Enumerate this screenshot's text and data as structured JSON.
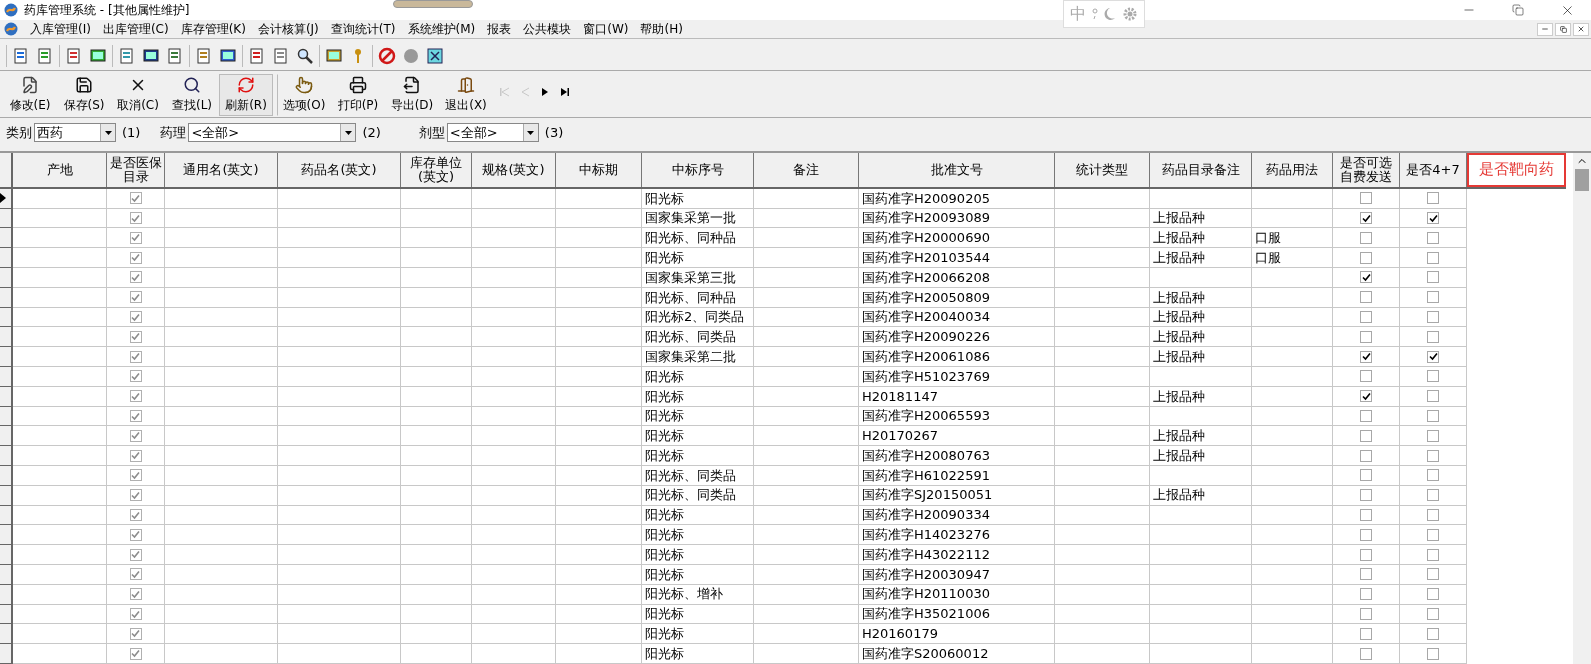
{
  "window": {
    "title": "药库管理系统 - [其他属性维护]"
  },
  "ime": {
    "label": "中"
  },
  "menu": [
    {
      "label": "入库管理(I)"
    },
    {
      "label": "出库管理(C)"
    },
    {
      "label": "库存管理(K)"
    },
    {
      "label": "会计核算(J)"
    },
    {
      "label": "查询统计(T)"
    },
    {
      "label": "系统维护(M)"
    },
    {
      "label": "报表"
    },
    {
      "label": "公共模块"
    },
    {
      "label": "窗口(W)"
    },
    {
      "label": "帮助(H)"
    }
  ],
  "toolbar": [
    {
      "label": "修改(E)",
      "kind": "edit",
      "pressed": false
    },
    {
      "label": "保存(S)",
      "kind": "save",
      "pressed": false
    },
    {
      "label": "取消(C)",
      "kind": "cancel",
      "pressed": false
    },
    {
      "label": "查找(L)",
      "kind": "find",
      "pressed": false
    },
    {
      "label": "刷新(R)",
      "kind": "refresh",
      "pressed": true
    },
    {
      "label": "选项(O)",
      "kind": "options",
      "pressed": false
    },
    {
      "label": "打印(P)",
      "kind": "print",
      "pressed": false
    },
    {
      "label": "导出(D)",
      "kind": "export",
      "pressed": false
    },
    {
      "label": "退出(X)",
      "kind": "exit",
      "pressed": false
    }
  ],
  "nav": [
    {
      "kind": "first",
      "disabled": true
    },
    {
      "kind": "prev",
      "disabled": true
    },
    {
      "kind": "next",
      "disabled": false
    },
    {
      "kind": "last",
      "disabled": false
    }
  ],
  "filters": [
    {
      "label": "类别",
      "value": "西药",
      "hint": "(1)"
    },
    {
      "label": "药理",
      "value": "<全部>",
      "hint": "(2)"
    },
    {
      "label": "剂型",
      "value": "<全部>",
      "hint": "(3)"
    }
  ],
  "table": {
    "columns": [
      {
        "label": "产地",
        "kind": "text",
        "highlighted": false
      },
      {
        "label": "是否医保目录",
        "kind": "check",
        "highlighted": false
      },
      {
        "label": "通用名(英文)",
        "kind": "text",
        "highlighted": false
      },
      {
        "label": "药品名(英文)",
        "kind": "text",
        "highlighted": false
      },
      {
        "label": "库存单位(英文)",
        "kind": "text",
        "highlighted": false
      },
      {
        "label": "规格(英文)",
        "kind": "text",
        "highlighted": false
      },
      {
        "label": "中标期",
        "kind": "text",
        "highlighted": false
      },
      {
        "label": "中标序号",
        "kind": "text",
        "highlighted": false
      },
      {
        "label": "备注",
        "kind": "text",
        "highlighted": false
      },
      {
        "label": "批准文号",
        "kind": "text",
        "highlighted": false
      },
      {
        "label": "统计类型",
        "kind": "text",
        "highlighted": false
      },
      {
        "label": "药品目录备注",
        "kind": "text",
        "highlighted": false
      },
      {
        "label": "药品用法",
        "kind": "text",
        "highlighted": false
      },
      {
        "label": "是否可选自费发送",
        "kind": "check",
        "highlighted": false
      },
      {
        "label": "是否4+7",
        "kind": "check",
        "highlighted": false
      },
      {
        "label": "是否靶向药",
        "kind": "none",
        "highlighted": true
      }
    ],
    "rows": [
      {
        "selected": true,
        "insured": true,
        "bid_no": "阳光标",
        "approval_no": "国药准字H20090205",
        "self_pay": false,
        "four_plus_seven": false
      },
      {
        "selected": false,
        "insured": true,
        "bid_no": "国家集采第一批",
        "approval_no": "国药准字H20093089",
        "catalog_note": "上报品种",
        "self_pay": true,
        "four_plus_seven": true
      },
      {
        "selected": false,
        "insured": true,
        "bid_no": "阳光标、同种品",
        "approval_no": "国药准字H20000690",
        "catalog_note": "上报品种",
        "usage": "口服",
        "self_pay": false,
        "four_plus_seven": false
      },
      {
        "selected": false,
        "insured": true,
        "bid_no": "阳光标",
        "approval_no": "国药准字H20103544",
        "catalog_note": "上报品种",
        "usage": "口服",
        "self_pay": false,
        "four_plus_seven": false
      },
      {
        "selected": false,
        "insured": true,
        "bid_no": "国家集采第三批",
        "approval_no": "国药准字H20066208",
        "self_pay": true,
        "four_plus_seven": false
      },
      {
        "selected": false,
        "insured": true,
        "bid_no": "阳光标、同种品",
        "approval_no": "国药准字H20050809",
        "catalog_note": "上报品种",
        "self_pay": false,
        "four_plus_seven": false
      },
      {
        "selected": false,
        "insured": true,
        "bid_no": "阳光标2、同类品",
        "approval_no": "国药准字H20040034",
        "catalog_note": "上报品种",
        "self_pay": false,
        "four_plus_seven": false
      },
      {
        "selected": false,
        "insured": true,
        "bid_no": "阳光标、同类品",
        "approval_no": "国药准字H20090226",
        "catalog_note": "上报品种",
        "self_pay": false,
        "four_plus_seven": false
      },
      {
        "selected": false,
        "insured": true,
        "bid_no": "国家集采第二批",
        "approval_no": "国药准字H20061086",
        "catalog_note": "上报品种",
        "self_pay": true,
        "four_plus_seven": true
      },
      {
        "selected": false,
        "insured": true,
        "bid_no": "阳光标",
        "approval_no": "国药准字H51023769",
        "self_pay": false,
        "four_plus_seven": false
      },
      {
        "selected": false,
        "insured": true,
        "bid_no": "阳光标",
        "approval_no": "H20181147",
        "catalog_note": "上报品种",
        "self_pay": true,
        "four_plus_seven": false
      },
      {
        "selected": false,
        "insured": true,
        "bid_no": "阳光标",
        "approval_no": "国药准字H20065593",
        "self_pay": false,
        "four_plus_seven": false
      },
      {
        "selected": false,
        "insured": true,
        "bid_no": "阳光标",
        "approval_no": "H20170267",
        "catalog_note": "上报品种",
        "self_pay": false,
        "four_plus_seven": false
      },
      {
        "selected": false,
        "insured": true,
        "bid_no": "阳光标",
        "approval_no": "国药准字H20080763",
        "catalog_note": "上报品种",
        "self_pay": false,
        "four_plus_seven": false
      },
      {
        "selected": false,
        "insured": true,
        "bid_no": "阳光标、同类品",
        "approval_no": "国药准字H61022591",
        "self_pay": false,
        "four_plus_seven": false
      },
      {
        "selected": false,
        "insured": true,
        "bid_no": "阳光标、同类品",
        "approval_no": "国药准字SJ20150051",
        "catalog_note": "上报品种",
        "self_pay": false,
        "four_plus_seven": false
      },
      {
        "selected": false,
        "insured": true,
        "bid_no": "阳光标",
        "approval_no": "国药准字H20090334",
        "self_pay": false,
        "four_plus_seven": false
      },
      {
        "selected": false,
        "insured": true,
        "bid_no": "阳光标",
        "approval_no": "国药准字H14023276",
        "self_pay": false,
        "four_plus_seven": false
      },
      {
        "selected": false,
        "insured": true,
        "bid_no": "阳光标",
        "approval_no": "国药准字H43022112",
        "self_pay": false,
        "four_plus_seven": false
      },
      {
        "selected": false,
        "insured": true,
        "bid_no": "阳光标",
        "approval_no": "国药准字H20030947",
        "self_pay": false,
        "four_plus_seven": false
      },
      {
        "selected": false,
        "insured": true,
        "bid_no": "阳光标、增补",
        "approval_no": "国药准字H20110030",
        "self_pay": false,
        "four_plus_seven": false
      },
      {
        "selected": false,
        "insured": true,
        "bid_no": "阳光标",
        "approval_no": "国药准字H35021006",
        "self_pay": false,
        "four_plus_seven": false
      },
      {
        "selected": false,
        "insured": true,
        "bid_no": "阳光标",
        "approval_no": "H20160179",
        "self_pay": false,
        "four_plus_seven": false
      },
      {
        "selected": false,
        "insured": true,
        "bid_no": "阳光标",
        "approval_no": "国药准字S20060012",
        "self_pay": false,
        "four_plus_seven": false
      }
    ]
  }
}
